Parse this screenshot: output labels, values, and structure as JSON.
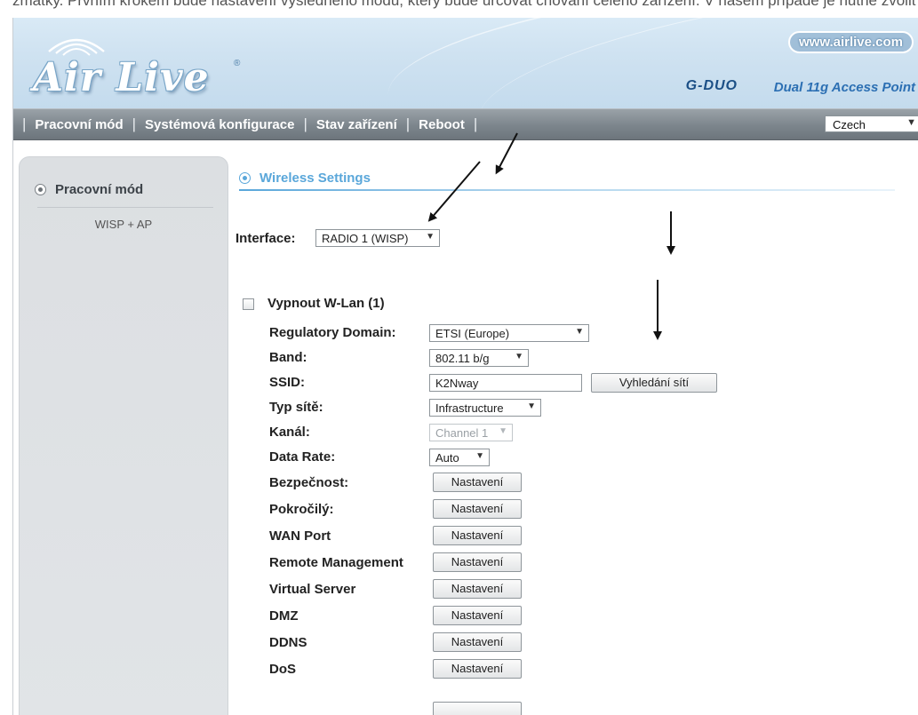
{
  "doc_fragment": "zmatky. Prvním krokem bude nastavení výsledného módu, který bude určovat chování celého zařízení. V našem případě je nutné zvolit kombinaci WISP + AP.",
  "header": {
    "logo_text": "Air Live",
    "logo_reg": "®",
    "url": "www.airlive.com",
    "model": "G-DUO",
    "model_desc": "Dual 11g Access Point"
  },
  "nav": {
    "items": [
      "Pracovní mód",
      "Systémová konfigurace",
      "Stav zařízení",
      "Reboot"
    ],
    "separator": "|",
    "language": "Czech"
  },
  "sidebar": {
    "title": "Pracovní mód",
    "sub": "WISP + AP"
  },
  "section": {
    "title": "Wireless Settings"
  },
  "interface": {
    "label": "Interface:",
    "value": "RADIO 1 (WISP)"
  },
  "wlan": {
    "checkbox_label": "Vypnout W-Lan (1)",
    "regulatory_label": "Regulatory Domain:",
    "regulatory_value": "ETSI (Europe)",
    "band_label": "Band:",
    "band_value": "802.11 b/g",
    "ssid_label": "SSID:",
    "ssid_value": "K2Nway",
    "scan_button": "Vyhledání sítí",
    "network_type_label": "Typ sítě:",
    "network_type_value": "Infrastructure",
    "channel_label": "Kanál:",
    "channel_value": "Channel 1",
    "data_rate_label": "Data Rate:",
    "data_rate_value": "Auto",
    "settings_rows": [
      {
        "label": "Bezpečnost:",
        "button": "Nastavení"
      },
      {
        "label": "Pokročilý:",
        "button": "Nastavení"
      },
      {
        "label": "WAN Port",
        "button": "Nastavení"
      },
      {
        "label": "Remote Management",
        "button": "Nastavení"
      },
      {
        "label": "Virtual Server",
        "button": "Nastavení"
      },
      {
        "label": "DMZ",
        "button": "Nastavení"
      },
      {
        "label": "DDNS",
        "button": "Nastavení"
      },
      {
        "label": "DoS",
        "button": "Nastavení"
      }
    ]
  }
}
